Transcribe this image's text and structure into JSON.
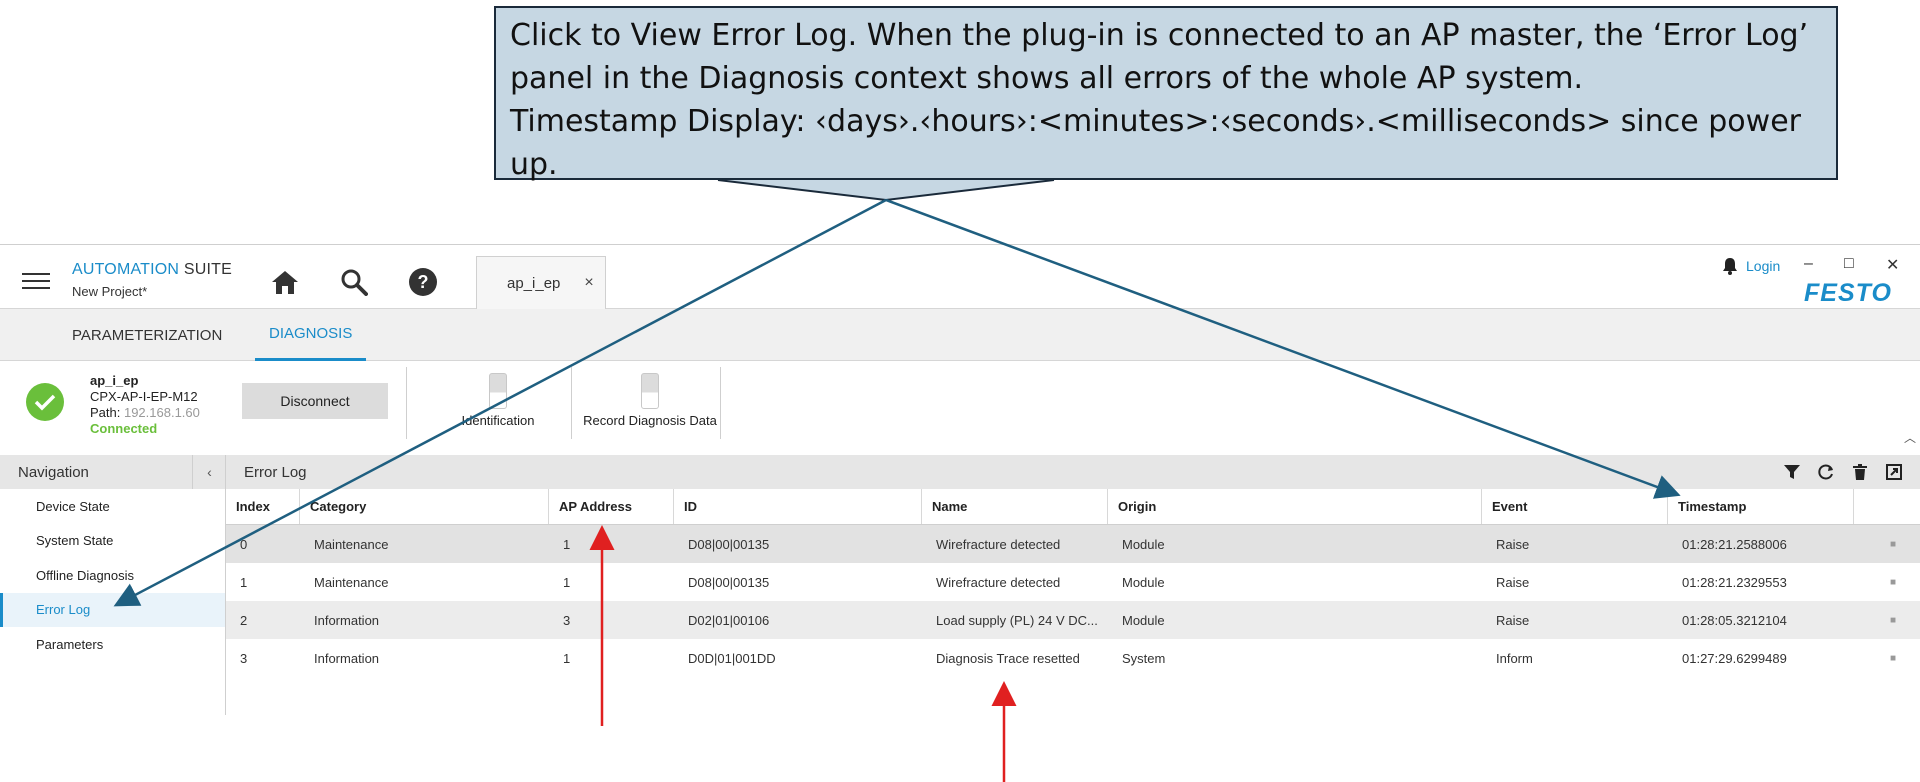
{
  "callout": {
    "line1": "Click to View Error Log. When the plug-in is connected to an AP master, the ‘Error Log’ panel in the Diagnosis context shows all errors of the whole AP system.",
    "line2": "Timestamp Display: ‹days›.‹hours›:<minutes>:‹seconds›.<milliseconds> since power up."
  },
  "app": {
    "brand_a": "AUTOMATION",
    "brand_b": " SUITE",
    "project": "New Project*",
    "doc_tab": "ap_i_ep",
    "doc_tab_close": "×",
    "login": "Login",
    "logo": "FESTO",
    "window_controls": {
      "minimize": "–",
      "maximize": "□",
      "close": "✕"
    },
    "icons": {
      "home": "home-icon",
      "search": "search-icon",
      "help": "?"
    }
  },
  "context_tabs": {
    "parameterization": "PARAMETERIZATION",
    "diagnosis": "DIAGNOSIS"
  },
  "device": {
    "name": "ap_i_ep",
    "model": "CPX-AP-I-EP-M12",
    "path_label": "Path: ",
    "path": "192.168.1.60",
    "status": "Connected",
    "disconnect": "Disconnect",
    "identification": "Identification",
    "record": "Record Diagnosis Data"
  },
  "navigation": {
    "title": "Navigation",
    "collapse": "‹",
    "items": [
      "Device State",
      "System State",
      "Offline Diagnosis",
      "Error Log",
      "Parameters"
    ],
    "active_index": 3
  },
  "panel": {
    "title": "Error Log"
  },
  "table": {
    "columns": [
      "Index",
      "Category",
      "AP Address",
      "ID",
      "Name",
      "Origin",
      "Event",
      "Timestamp"
    ],
    "rows": [
      [
        "0",
        "Maintenance",
        "1",
        "D08|00|00135",
        "Wirefracture detected",
        "Module",
        "Raise",
        "01:28:21.2588006"
      ],
      [
        "1",
        "Maintenance",
        "1",
        "D08|00|00135",
        "Wirefracture detected",
        "Module",
        "Raise",
        "01:28:21.2329553"
      ],
      [
        "2",
        "Information",
        "3",
        "D02|01|00106",
        "Load supply (PL) 24 V DC...",
        "Module",
        "Raise",
        "01:28:05.3212104"
      ],
      [
        "3",
        "Information",
        "1",
        "D0D|01|001DD",
        "Diagnosis Trace resetted",
        "System",
        "Inform",
        "01:27:29.6299489"
      ]
    ],
    "row_marker": "■"
  },
  "colors": {
    "accent": "#1a8cc9",
    "connected": "#6abf3b",
    "callout_bg": "#c6d7e3",
    "annotation_arrow": "#1f5f80",
    "red_arrow": "#e02020"
  }
}
